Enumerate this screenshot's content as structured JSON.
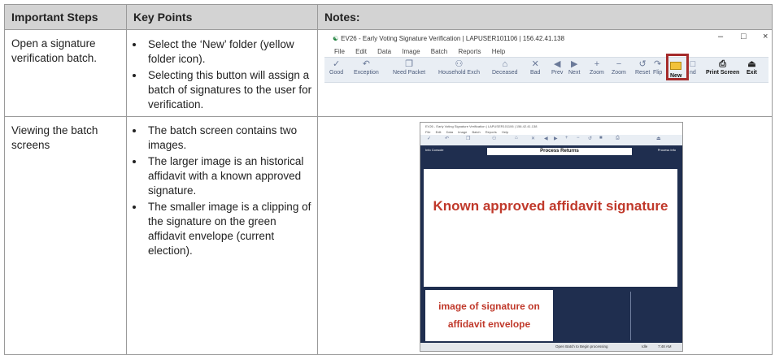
{
  "headers": {
    "steps": "Important Steps",
    "points": "Key Points",
    "notes": "Notes:"
  },
  "rows": [
    {
      "step": "Open a signature verification batch.",
      "points": [
        "Select the ‘New’ folder (yellow folder icon).",
        "Selecting this button will assign a batch of signatures to the user for verification."
      ]
    },
    {
      "step": "Viewing the batch screens",
      "points": [
        "The batch screen contains two images.",
        "The larger image is an historical affidavit with a known approved signature.",
        "The smaller image is a clipping of the signature on the green affidavit envelope (current election)."
      ]
    }
  ],
  "window1": {
    "title": "EV26 - Early Voting Signature Verification | LAPUSER101106 | 156.42.41.138",
    "controls": {
      "minimize": "–",
      "maximize": "□",
      "close": "×"
    },
    "menu": [
      "File",
      "Edit",
      "Data",
      "Image",
      "Batch",
      "Reports",
      "Help"
    ],
    "toolbar": [
      {
        "label": "Good",
        "icon": "✓"
      },
      {
        "label": "Exception",
        "icon": "↶"
      },
      {
        "label": "Need Packet",
        "icon": "❐"
      },
      {
        "label": "Household Exch",
        "icon": "⚇"
      },
      {
        "label": "Deceased",
        "icon": "⌂"
      },
      {
        "label": "Bad",
        "icon": "✕"
      },
      {
        "label": "Prev",
        "icon": "◀"
      },
      {
        "label": "Next",
        "icon": "▶"
      },
      {
        "label": "Zoom",
        "icon": "+"
      },
      {
        "label": "Zoom",
        "icon": "−"
      },
      {
        "label": "Reset",
        "icon": "↺"
      },
      {
        "label": "Flip",
        "icon": "↷"
      },
      {
        "label": "New",
        "icon": ""
      },
      {
        "label": "nd",
        "icon": "□"
      },
      {
        "label": "Print Screen",
        "icon": "⎙"
      },
      {
        "label": "Exit",
        "icon": "⏏"
      }
    ],
    "highlight_color": "#a52c2c"
  },
  "window2": {
    "title": "EV26 - Early Voting Signature Verification | LAPUSER101106 | 156.42.41.138",
    "menu": [
      "File",
      "Edit",
      "Data",
      "Image",
      "Batch",
      "Reports",
      "Help"
    ],
    "process_bar": "Process Returns",
    "big_label": "Known approved affidavit signature",
    "small_label": "image of signature on affidavit envelope",
    "status": {
      "main": "Open Batch to Begin processing",
      "mid": "Idle",
      "right": "7:48 AM"
    },
    "label_color": "#c0392b",
    "navy": "#1f2e4f"
  }
}
